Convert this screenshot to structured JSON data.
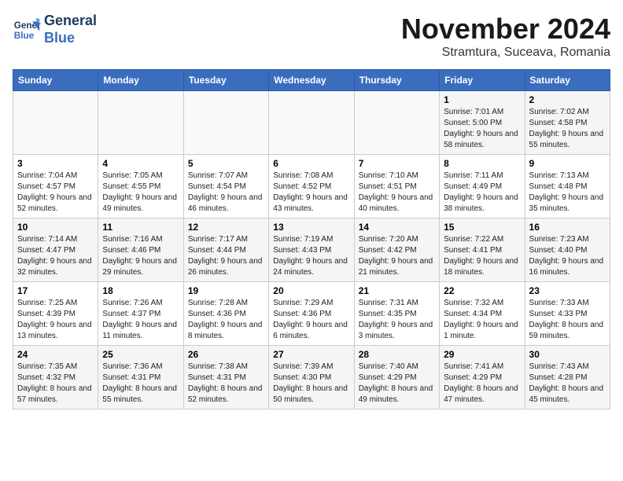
{
  "logo": {
    "line1": "General",
    "line2": "Blue"
  },
  "title": "November 2024",
  "subtitle": "Stramtura, Suceava, Romania",
  "weekdays": [
    "Sunday",
    "Monday",
    "Tuesday",
    "Wednesday",
    "Thursday",
    "Friday",
    "Saturday"
  ],
  "weeks": [
    [
      {
        "day": "",
        "info": ""
      },
      {
        "day": "",
        "info": ""
      },
      {
        "day": "",
        "info": ""
      },
      {
        "day": "",
        "info": ""
      },
      {
        "day": "",
        "info": ""
      },
      {
        "day": "1",
        "info": "Sunrise: 7:01 AM\nSunset: 5:00 PM\nDaylight: 9 hours and 58 minutes."
      },
      {
        "day": "2",
        "info": "Sunrise: 7:02 AM\nSunset: 4:58 PM\nDaylight: 9 hours and 55 minutes."
      }
    ],
    [
      {
        "day": "3",
        "info": "Sunrise: 7:04 AM\nSunset: 4:57 PM\nDaylight: 9 hours and 52 minutes."
      },
      {
        "day": "4",
        "info": "Sunrise: 7:05 AM\nSunset: 4:55 PM\nDaylight: 9 hours and 49 minutes."
      },
      {
        "day": "5",
        "info": "Sunrise: 7:07 AM\nSunset: 4:54 PM\nDaylight: 9 hours and 46 minutes."
      },
      {
        "day": "6",
        "info": "Sunrise: 7:08 AM\nSunset: 4:52 PM\nDaylight: 9 hours and 43 minutes."
      },
      {
        "day": "7",
        "info": "Sunrise: 7:10 AM\nSunset: 4:51 PM\nDaylight: 9 hours and 40 minutes."
      },
      {
        "day": "8",
        "info": "Sunrise: 7:11 AM\nSunset: 4:49 PM\nDaylight: 9 hours and 38 minutes."
      },
      {
        "day": "9",
        "info": "Sunrise: 7:13 AM\nSunset: 4:48 PM\nDaylight: 9 hours and 35 minutes."
      }
    ],
    [
      {
        "day": "10",
        "info": "Sunrise: 7:14 AM\nSunset: 4:47 PM\nDaylight: 9 hours and 32 minutes."
      },
      {
        "day": "11",
        "info": "Sunrise: 7:16 AM\nSunset: 4:46 PM\nDaylight: 9 hours and 29 minutes."
      },
      {
        "day": "12",
        "info": "Sunrise: 7:17 AM\nSunset: 4:44 PM\nDaylight: 9 hours and 26 minutes."
      },
      {
        "day": "13",
        "info": "Sunrise: 7:19 AM\nSunset: 4:43 PM\nDaylight: 9 hours and 24 minutes."
      },
      {
        "day": "14",
        "info": "Sunrise: 7:20 AM\nSunset: 4:42 PM\nDaylight: 9 hours and 21 minutes."
      },
      {
        "day": "15",
        "info": "Sunrise: 7:22 AM\nSunset: 4:41 PM\nDaylight: 9 hours and 18 minutes."
      },
      {
        "day": "16",
        "info": "Sunrise: 7:23 AM\nSunset: 4:40 PM\nDaylight: 9 hours and 16 minutes."
      }
    ],
    [
      {
        "day": "17",
        "info": "Sunrise: 7:25 AM\nSunset: 4:39 PM\nDaylight: 9 hours and 13 minutes."
      },
      {
        "day": "18",
        "info": "Sunrise: 7:26 AM\nSunset: 4:37 PM\nDaylight: 9 hours and 11 minutes."
      },
      {
        "day": "19",
        "info": "Sunrise: 7:28 AM\nSunset: 4:36 PM\nDaylight: 9 hours and 8 minutes."
      },
      {
        "day": "20",
        "info": "Sunrise: 7:29 AM\nSunset: 4:36 PM\nDaylight: 9 hours and 6 minutes."
      },
      {
        "day": "21",
        "info": "Sunrise: 7:31 AM\nSunset: 4:35 PM\nDaylight: 9 hours and 3 minutes."
      },
      {
        "day": "22",
        "info": "Sunrise: 7:32 AM\nSunset: 4:34 PM\nDaylight: 9 hours and 1 minute."
      },
      {
        "day": "23",
        "info": "Sunrise: 7:33 AM\nSunset: 4:33 PM\nDaylight: 8 hours and 59 minutes."
      }
    ],
    [
      {
        "day": "24",
        "info": "Sunrise: 7:35 AM\nSunset: 4:32 PM\nDaylight: 8 hours and 57 minutes."
      },
      {
        "day": "25",
        "info": "Sunrise: 7:36 AM\nSunset: 4:31 PM\nDaylight: 8 hours and 55 minutes."
      },
      {
        "day": "26",
        "info": "Sunrise: 7:38 AM\nSunset: 4:31 PM\nDaylight: 8 hours and 52 minutes."
      },
      {
        "day": "27",
        "info": "Sunrise: 7:39 AM\nSunset: 4:30 PM\nDaylight: 8 hours and 50 minutes."
      },
      {
        "day": "28",
        "info": "Sunrise: 7:40 AM\nSunset: 4:29 PM\nDaylight: 8 hours and 49 minutes."
      },
      {
        "day": "29",
        "info": "Sunrise: 7:41 AM\nSunset: 4:29 PM\nDaylight: 8 hours and 47 minutes."
      },
      {
        "day": "30",
        "info": "Sunrise: 7:43 AM\nSunset: 4:28 PM\nDaylight: 8 hours and 45 minutes."
      }
    ]
  ]
}
